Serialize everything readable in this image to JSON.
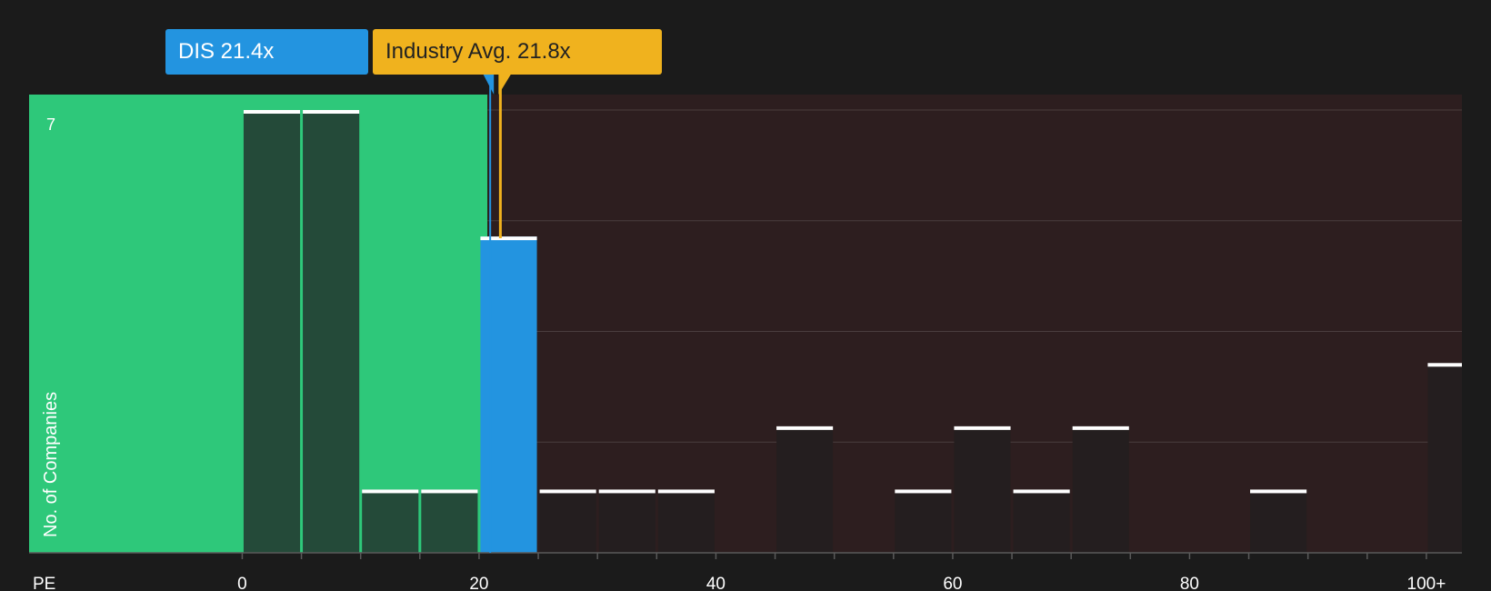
{
  "callouts": {
    "company": {
      "label": "DIS 21.4x",
      "value": 21.4,
      "color": "#2394e0"
    },
    "industry": {
      "label": "Industry Avg. 21.8x",
      "value": 21.8,
      "color": "#f0b21e"
    }
  },
  "colors": {
    "background": "#1b1b1b",
    "undervalued_zone": "#2ec87a",
    "overvalued_zone": "#2d1e1f",
    "bar_in_green": "#244a39",
    "bar_in_red": "#241e1f",
    "bar_highlight": "#2394e0",
    "bar_top_line": "#ffffff"
  },
  "chart_data": {
    "type": "bar",
    "xlabel": "PE",
    "ylabel": "No. of Companies",
    "xlim": [
      -18,
      103
    ],
    "ylim": [
      0,
      7
    ],
    "grid": true,
    "x_ticks": [
      {
        "value": 0,
        "label": "0"
      },
      {
        "value": 20,
        "label": "20"
      },
      {
        "value": 40,
        "label": "40"
      },
      {
        "value": 60,
        "label": "60"
      },
      {
        "value": 80,
        "label": "80"
      },
      {
        "value": 100,
        "label": "100+"
      }
    ],
    "y_ticks": [
      {
        "value": 7,
        "label": "7"
      }
    ],
    "bin_width": 5,
    "bins": [
      {
        "start": 0,
        "count": 7
      },
      {
        "start": 5,
        "count": 7
      },
      {
        "start": 10,
        "count": 1
      },
      {
        "start": 15,
        "count": 1
      },
      {
        "start": 20,
        "count": 5,
        "highlight": true
      },
      {
        "start": 25,
        "count": 1
      },
      {
        "start": 30,
        "count": 1
      },
      {
        "start": 35,
        "count": 1
      },
      {
        "start": 45,
        "count": 2
      },
      {
        "start": 55,
        "count": 1
      },
      {
        "start": 60,
        "count": 2
      },
      {
        "start": 65,
        "count": 1
      },
      {
        "start": 70,
        "count": 2
      },
      {
        "start": 85,
        "count": 1
      },
      {
        "start": 100,
        "count": 3
      }
    ]
  }
}
